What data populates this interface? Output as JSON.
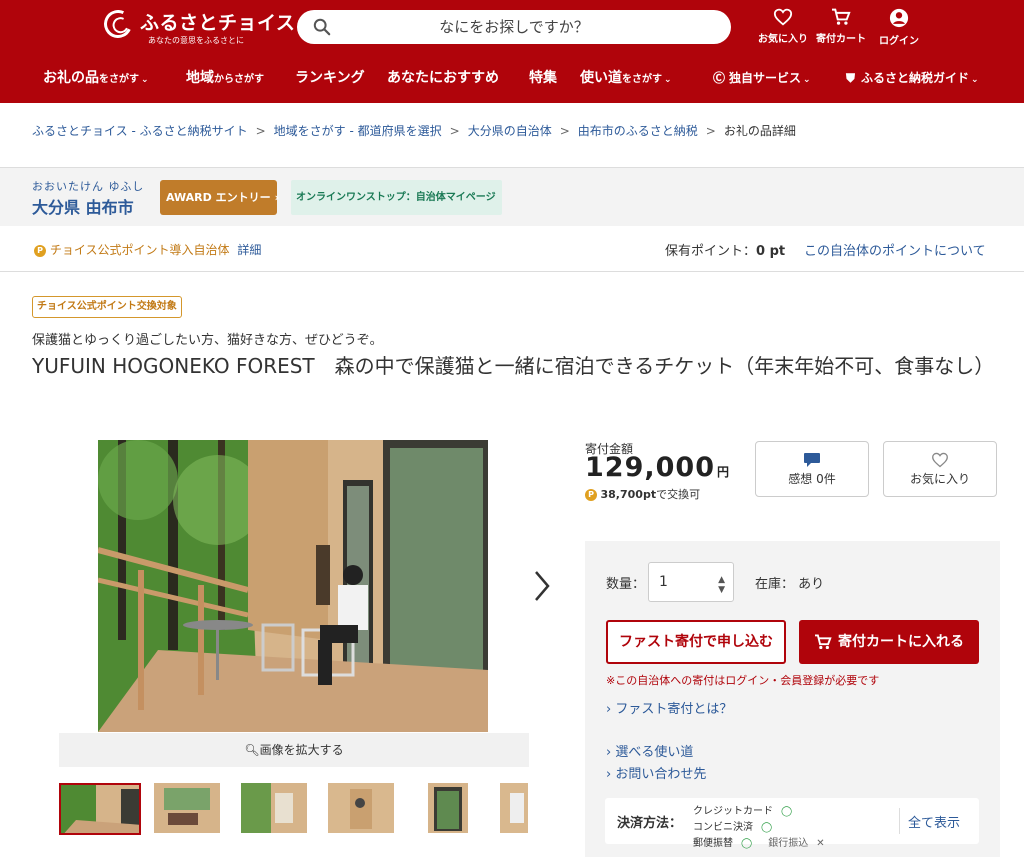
{
  "header": {
    "logo_text": "ふるさとチョイス",
    "logo_tagline": "あなたの意思をふるさとに",
    "search_placeholder": "なにをお探しですか？",
    "icons": [
      {
        "name": "heart-icon",
        "label": "お気に入り"
      },
      {
        "name": "cart-icon",
        "label": "寄付カート"
      },
      {
        "name": "user-icon",
        "label": "ログイン"
      }
    ],
    "nav": [
      {
        "main": "お礼の品",
        "sub": "をさがす",
        "chev": true
      },
      {
        "main": "地域",
        "sub": "からさがす",
        "chev": false
      },
      {
        "main": "ランキング",
        "sub": "",
        "chev": false
      },
      {
        "main": "あなたにおすすめ",
        "sub": "",
        "chev": false
      },
      {
        "main": "特集",
        "sub": "",
        "chev": false
      },
      {
        "main": "使い道",
        "sub": "をさがす",
        "chev": true
      },
      {
        "main": "独自サービス",
        "sub": "",
        "chev": true
      },
      {
        "main": "ふるさと納税ガイド",
        "sub": "",
        "chev": true
      }
    ]
  },
  "breadcrumb": [
    "ふるさとチョイス - ふるさと納税サイト",
    "地域をさがす - 都道府県を選択",
    "大分県の自治体",
    "由布市のふるさと納税",
    "お礼の品詳細"
  ],
  "municipality": {
    "kana": "おおいたけん ゆふし",
    "name": "大分県 由布市",
    "award_label": "AWARD エントリー",
    "online_label": "オンラインワンストップ：自治体マイページ"
  },
  "points": {
    "official_label": "チョイス公式ポイント導入自治体",
    "detail_link": "詳細",
    "owned_label": "保有ポイント：",
    "owned_value": "0 pt",
    "about_link": "この自治体のポイントについて"
  },
  "product": {
    "tag": "チョイス公式ポイント交換対象",
    "catch": "保護猫とゆっくり過ごしたい方、猫好きな方、ぜひどうぞ。",
    "title": "YUFUIN HOGONEKO FOREST　森の中で保護猫と一緒に宿泊できるチケット（年末年始不可、食事なし）",
    "zoom_label": "画像を拡大する",
    "price_label": "寄付金額",
    "price": "129,000",
    "price_unit": "円",
    "points_exchange": "38,700pt",
    "points_exchange_suffix": "で交換可",
    "review_label": "感想 0件",
    "favorite_label": "お気に入り"
  },
  "cart": {
    "qty_label": "数量：",
    "qty_value": "1",
    "stock_label": "在庫： あり",
    "fast_button": "ファスト寄付で申し込む",
    "cart_button": "寄付カートに入れる",
    "notice": "※この自治体への寄付はログイン・会員登録が必要です",
    "links": [
      "ファスト寄付とは？",
      "選べる使い道",
      "お問い合わせ先"
    ],
    "payment_label": "決済方法：",
    "payment_methods": [
      {
        "name": "クレジットカード",
        "mark": "◯"
      },
      {
        "name": "コンビニ決済",
        "mark": "◯"
      },
      {
        "name": "郵便振替",
        "mark": "◯"
      },
      {
        "name": "銀行振込",
        "mark": "✕"
      }
    ],
    "payment_all": "全て表示"
  },
  "colors": {
    "brand": "#b0040b",
    "link": "#2d5a99",
    "award": "#c07c2a",
    "point": "#e0a020"
  }
}
